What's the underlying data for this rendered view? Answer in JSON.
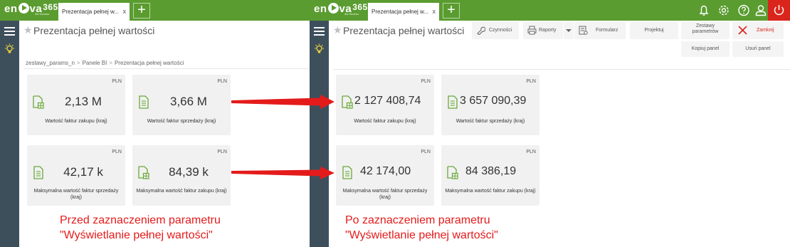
{
  "app": {
    "logo_text_a": "en",
    "logo_text_b": "va",
    "logo_number": "365",
    "logo_sub": "dla biznesu",
    "tab_label": "Prezentacja pełnej w...",
    "tab_close": "x",
    "new_tab": "+",
    "page_title": "Prezentacja pełnej wartości",
    "brand_color": "#5a9c30",
    "sidebar_color": "#3e4f5c",
    "accent_red": "#d9251c"
  },
  "left": {
    "breadcrumb": [
      "zestawy_params_n",
      "Panele BI",
      "Prezentacja pełnej wartości"
    ],
    "cards": [
      {
        "currency": "PLN",
        "icon": "invoice-purchase-icon",
        "value": "2,13 M",
        "label": "Wartość faktur zakupu (kraj)"
      },
      {
        "currency": "PLN",
        "icon": "invoice-sales-icon",
        "value": "3,66 M",
        "label": "Wartość faktur sprzedaży (kraj)"
      },
      {
        "currency": "PLN",
        "icon": "invoice-sales-icon",
        "value": "42,17 k",
        "label": "Maksymalna wartość faktur sprzedaży (kraj)"
      },
      {
        "currency": "PLN",
        "icon": "invoice-purchase-icon",
        "value": "84,39 k",
        "label": "Maksymalna wartość faktur zakupu (kraj)"
      }
    ],
    "caption_line1": "Przed zaznaczeniem parametru",
    "caption_line2": "\"Wyświetlanie pełnej wartości\""
  },
  "right": {
    "toolbar": {
      "actions": "Czynności",
      "reports": "Raporty",
      "form": "Formularz",
      "projektuj": "Projektuj",
      "param_sets_line1": "Zestawy",
      "param_sets_line2": "parametrów",
      "close": "Zamknij",
      "copy_panel": "Kopiuj panel",
      "delete_panel": "Usuń panel"
    },
    "cards": [
      {
        "currency": "PLN",
        "icon": "invoice-purchase-icon",
        "value": "2 127 408,74",
        "label": "Wartość faktur zakupu (kraj)"
      },
      {
        "currency": "PLN",
        "icon": "invoice-sales-icon",
        "value": "3 657 090,39",
        "label": "Wartość faktur sprzedaży (kraj)"
      },
      {
        "currency": "PLN",
        "icon": "invoice-sales-icon",
        "value": "42 174,00",
        "label": "Maksymalna wartość faktur sprzedaży (kraj)"
      },
      {
        "currency": "PLN",
        "icon": "invoice-purchase-icon",
        "value": "84 386,19",
        "label": "Maksymalna wartość faktur zakupu (kraj)"
      }
    ],
    "caption_line1": "Po zaznaczeniem parametru",
    "caption_line2": "\"Wyświetlanie pełnej wartości\""
  },
  "top_icons": [
    "bell-icon",
    "gear-icon",
    "help-icon",
    "user-icon",
    "power-icon"
  ]
}
